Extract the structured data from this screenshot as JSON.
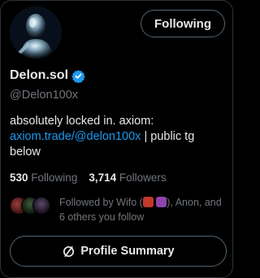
{
  "profile": {
    "display_name": "Delon.sol",
    "handle": "@Delon100x",
    "bio_text": "absolutely locked in. axiom:",
    "bio_link": "axiom.trade/@delon100x",
    "bio_rest": " | public tg below",
    "follow_button": "Following"
  },
  "stats": {
    "following_count": "530",
    "following_label": "Following",
    "followers_count": "3,714",
    "followers_label": "Followers"
  },
  "followed_by": {
    "prefix": "Followed by Wifo (",
    "sep": " ",
    "suffix": "), Anon, and 6 others you follow"
  },
  "actions": {
    "profile_summary": "Profile Summary"
  },
  "colors": {
    "accent": "#1d9bf0",
    "muted": "#71767b",
    "text": "#e7e9ea",
    "border": "#536471"
  },
  "icons": {
    "verified": "verified-badge-icon",
    "summary": "profile-summary-icon"
  }
}
